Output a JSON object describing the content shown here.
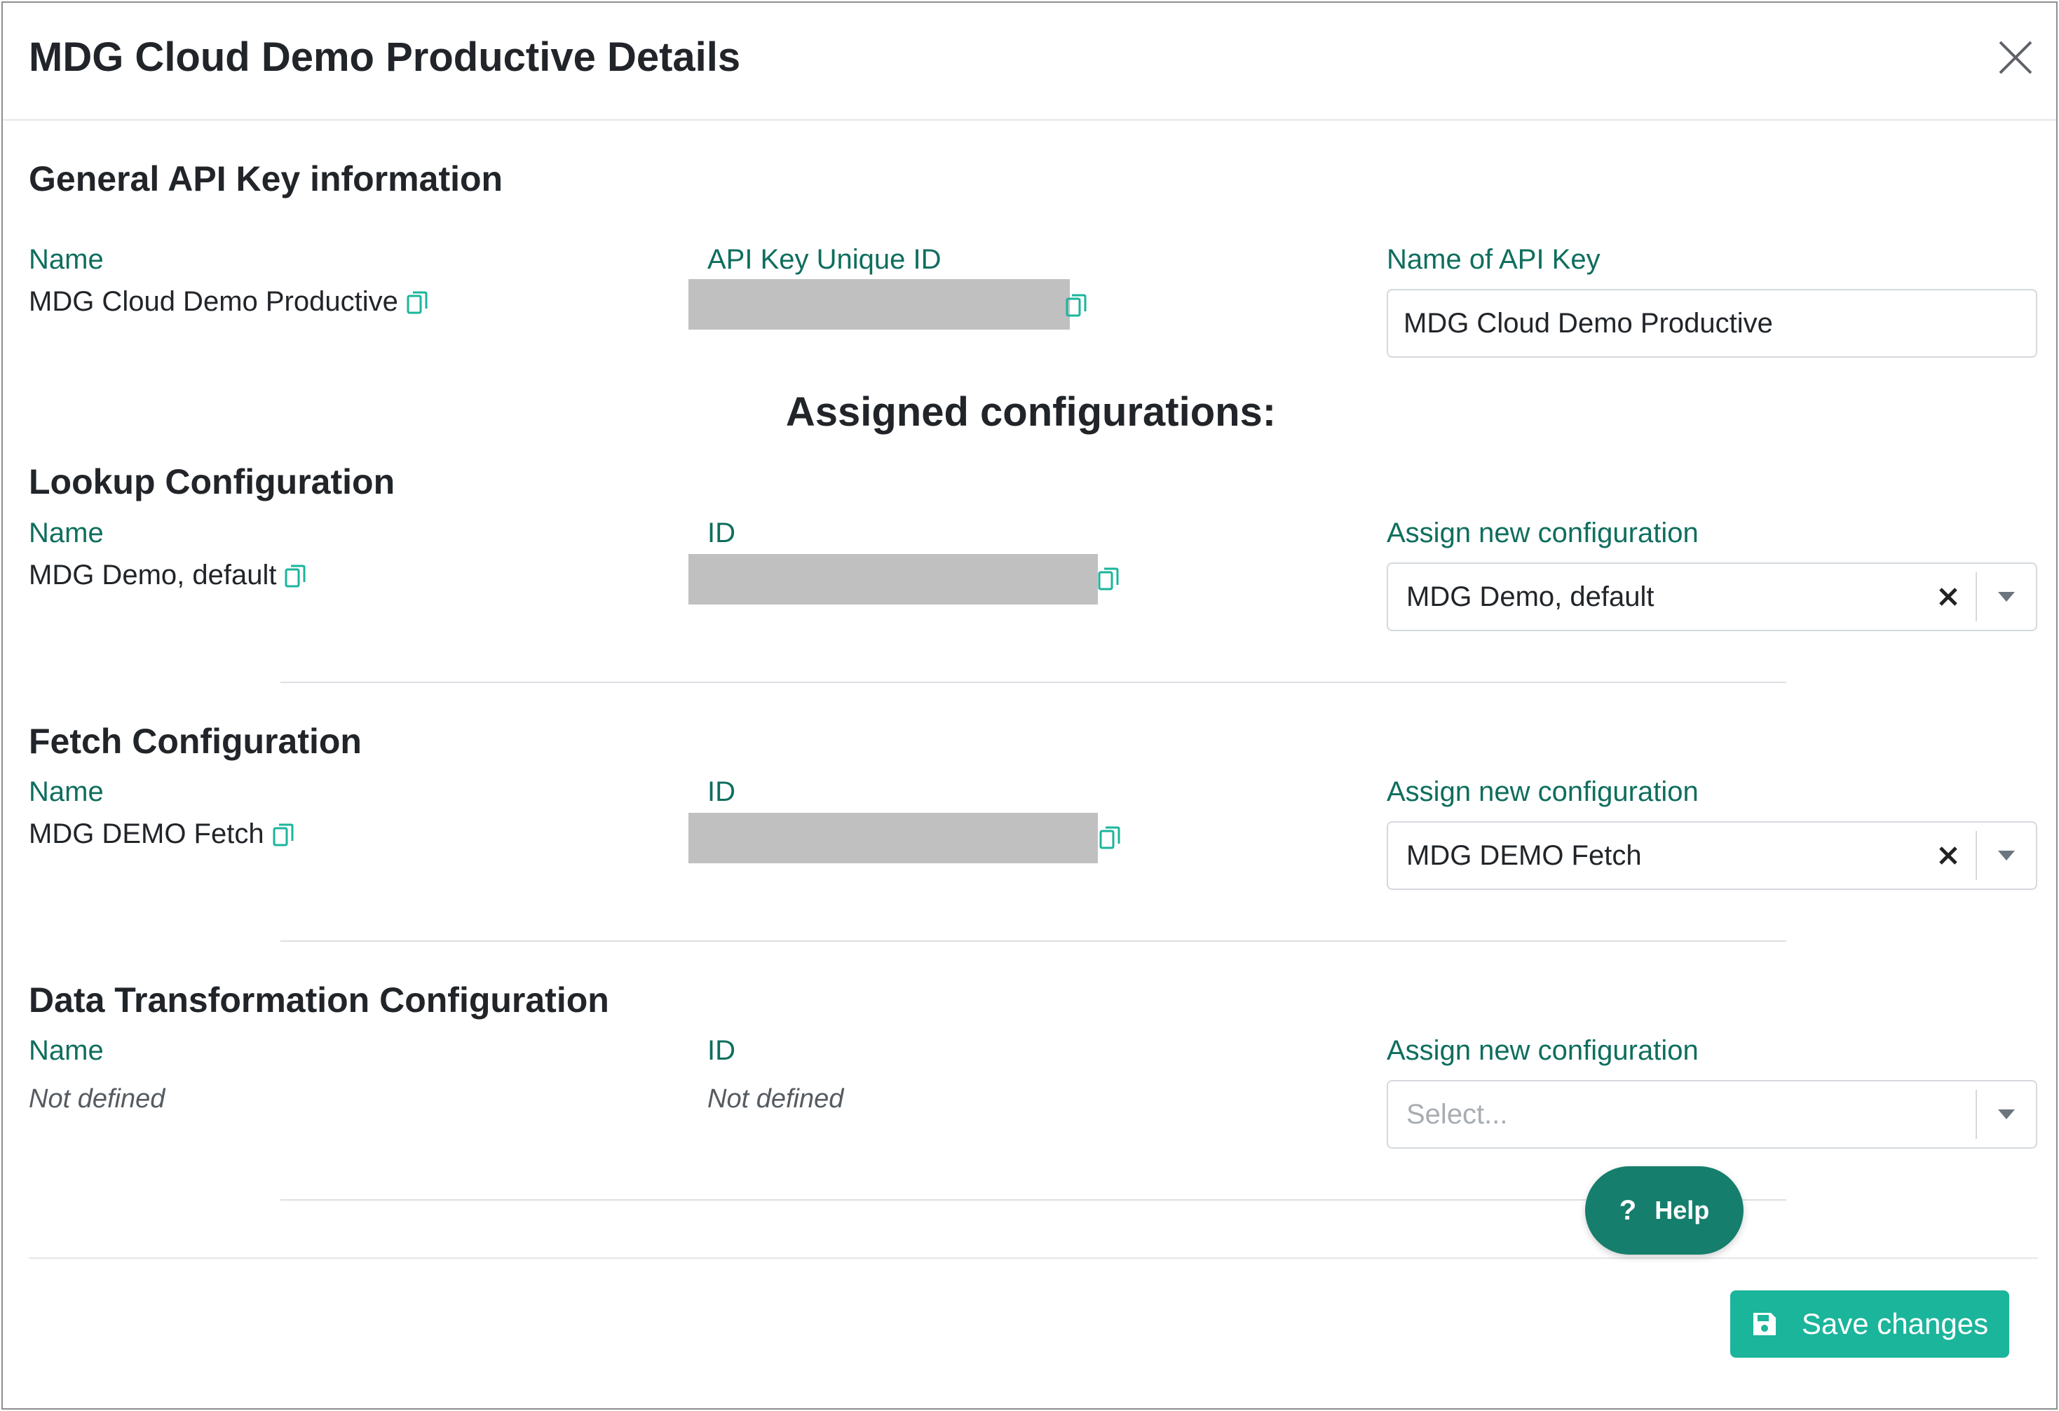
{
  "modal": {
    "title": "MDG Cloud Demo Productive Details"
  },
  "general": {
    "section_title": "General API Key information",
    "name_label": "Name",
    "name_value": "MDG Cloud Demo Productive",
    "uid_label": "API Key Unique ID",
    "key_name_label": "Name of API Key",
    "key_name_value": "MDG Cloud Demo Productive"
  },
  "assigned_title": "Assigned configurations:",
  "lookup": {
    "section_title": "Lookup Configuration",
    "name_label": "Name",
    "name_value": "MDG Demo, default",
    "id_label": "ID",
    "assign_label": "Assign new configuration",
    "assign_value": "MDG Demo, default"
  },
  "fetch": {
    "section_title": "Fetch Configuration",
    "name_label": "Name",
    "name_value": "MDG DEMO Fetch",
    "id_label": "ID",
    "assign_label": "Assign new configuration",
    "assign_value": "MDG DEMO Fetch"
  },
  "transform": {
    "section_title": "Data Transformation Configuration",
    "name_label": "Name",
    "name_value": "Not defined",
    "id_label": "ID",
    "id_value": "Not defined",
    "assign_label": "Assign new configuration",
    "assign_placeholder": "Select..."
  },
  "help_button": {
    "icon": "question-icon",
    "label": "Help"
  },
  "save_button": {
    "icon": "floppy-disk-icon",
    "label": "Save changes"
  },
  "colors": {
    "label_text": "#0f6e5e",
    "copy_icon": "#1bb59b",
    "help_bg": "#167e6c",
    "save_bg": "#1bb59b",
    "redacted": "#c0c0c0"
  }
}
